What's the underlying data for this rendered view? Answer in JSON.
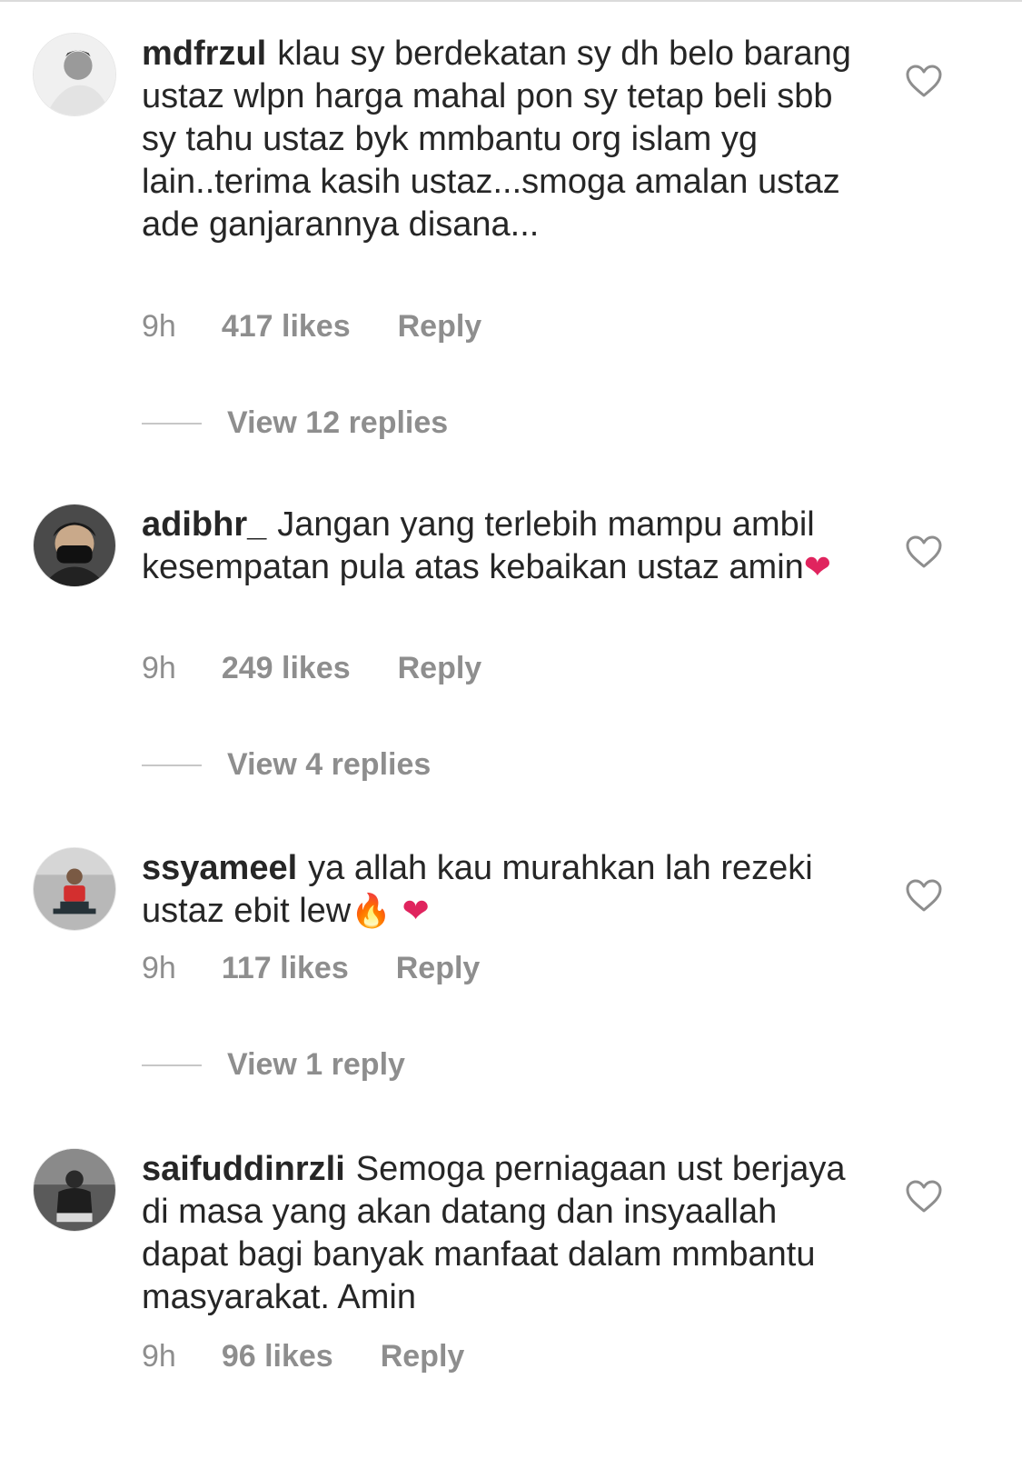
{
  "comments": [
    {
      "username": "mdfrzul",
      "text": "klau sy berdekatan sy dh belo barang ustaz wlpn harga mahal pon sy tetap beli sbb sy tahu ustaz byk mmbantu org islam yg lain..terima kasih ustaz...smoga amalan ustaz ade ganjarannya disana...",
      "emoji": "",
      "time": "9h",
      "likes": "417 likes",
      "reply_label": "Reply",
      "view_replies": "View 12 replies"
    },
    {
      "username": "adibhr_",
      "text": "Jangan yang terlebih mampu ambil kesempatan pula atas kebaikan ustaz amin",
      "emoji": "❤",
      "time": "9h",
      "likes": "249 likes",
      "reply_label": "Reply",
      "view_replies": "View 4 replies"
    },
    {
      "username": "ssyameel",
      "text": "ya allah kau murahkan lah rezeki ustaz ebit lew",
      "emoji_fire": "🔥",
      "emoji_heart": " ❤",
      "time": "9h",
      "likes": "117 likes",
      "reply_label": "Reply",
      "view_replies": "View 1 reply"
    },
    {
      "username": "saifuddinrzli",
      "text": "Semoga perniagaan ust berjaya di masa yang akan datang dan insyaallah dapat bagi banyak manfaat dalam mmbantu masyarakat. Amin",
      "emoji": "",
      "time": "9h",
      "likes": "96 likes",
      "reply_label": "Reply"
    }
  ],
  "icons": {
    "like": "heart-outline-icon"
  },
  "colors": {
    "text": "#262626",
    "muted": "#8e8e8e",
    "heart": "#e0245e"
  }
}
